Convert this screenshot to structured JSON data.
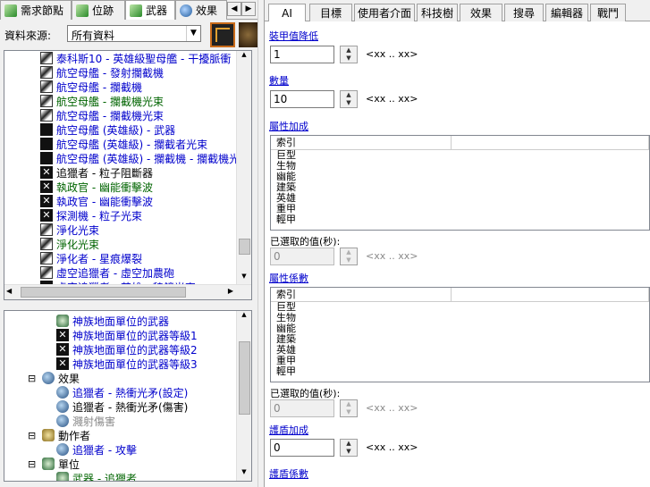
{
  "left_tabs": [
    {
      "label": "需求節點",
      "icon": "green"
    },
    {
      "label": "位跡",
      "icon": "green"
    },
    {
      "label": "武器",
      "icon": "green"
    },
    {
      "label": "效果",
      "icon": "blue"
    }
  ],
  "right_tabs": [
    "AI",
    "目標",
    "使用者介面",
    "科技樹",
    "效果",
    "搜尋",
    "編輯器",
    "戰鬥"
  ],
  "source": {
    "label": "資料來源:",
    "value": "所有資料"
  },
  "weapon_list": [
    {
      "text": "泰科斯10 - 英雄級聖母艦 - 干擾脈衝",
      "color": "blue",
      "icon": "leaf"
    },
    {
      "text": "航空母艦 - 發射攔截機",
      "color": "blue",
      "icon": "leaf"
    },
    {
      "text": "航空母艦 - 攔截機",
      "color": "blue",
      "icon": "leaf"
    },
    {
      "text": "航空母艦 - 攔截機光束",
      "color": "green",
      "icon": "leaf"
    },
    {
      "text": "航空母艦 - 攔截機光束",
      "color": "blue",
      "icon": "leaf"
    },
    {
      "text": "航空母艦 (英雄級) - 武器",
      "color": "blue",
      "icon": "dark"
    },
    {
      "text": "航空母艦 (英雄級) - 攔截者光束",
      "color": "blue",
      "icon": "dark"
    },
    {
      "text": "航空母艦 (英雄級) - 攔截機 - 攔截機光束",
      "color": "blue",
      "icon": "dark"
    },
    {
      "text": "追獵者 - 粒子阻斷器",
      "color": "black",
      "icon": "x"
    },
    {
      "text": "執政官 - 幽能衝擊波",
      "color": "green",
      "icon": "x"
    },
    {
      "text": "執政官 - 幽能衝擊波",
      "color": "blue",
      "icon": "x"
    },
    {
      "text": "探測機 - 粒子光束",
      "color": "blue",
      "icon": "x"
    },
    {
      "text": "淨化光束",
      "color": "blue",
      "icon": "leaf"
    },
    {
      "text": "淨化光束",
      "color": "green",
      "icon": "leaf"
    },
    {
      "text": "淨化者 - 星痕爆裂",
      "color": "blue",
      "icon": "leaf"
    },
    {
      "text": "虛空追獵者 - 虛空加農砲",
      "color": "blue",
      "icon": "leaf"
    },
    {
      "text": "虛空追獵者 - 英雄 - 稜鏡光束",
      "color": "blue",
      "icon": "dark"
    }
  ],
  "tree": [
    {
      "text": "神族地面單位的武器",
      "color": "blue",
      "icon": "bug",
      "indent": 58,
      "toggle": ""
    },
    {
      "text": "神族地面單位的武器等級1",
      "color": "blue",
      "icon": "x",
      "indent": 58,
      "toggle": ""
    },
    {
      "text": "神族地面單位的武器等級2",
      "color": "blue",
      "icon": "x",
      "indent": 58,
      "toggle": ""
    },
    {
      "text": "神族地面單位的武器等級3",
      "color": "blue",
      "icon": "x",
      "indent": 58,
      "toggle": ""
    },
    {
      "text": "效果",
      "color": "black",
      "icon": "ball",
      "indent": 26,
      "toggle": "⊟"
    },
    {
      "text": "追獵者 - 熱衝光矛(設定)",
      "color": "blue",
      "icon": "ball",
      "indent": 58,
      "toggle": ""
    },
    {
      "text": "追獵者 - 熱衝光矛(傷害)",
      "color": "black",
      "icon": "ball",
      "indent": 58,
      "toggle": ""
    },
    {
      "text": "濺射傷害",
      "color": "gray",
      "icon": "ball",
      "indent": 58,
      "toggle": ""
    },
    {
      "text": "動作者",
      "color": "black",
      "icon": "gold",
      "indent": 26,
      "toggle": "⊟"
    },
    {
      "text": "追獵者 - 攻擊",
      "color": "blue",
      "icon": "ball",
      "indent": 58,
      "toggle": ""
    },
    {
      "text": "單位",
      "color": "black",
      "icon": "bug",
      "indent": 26,
      "toggle": "⊟"
    },
    {
      "text": "武器 - 追獵者",
      "color": "green",
      "icon": "bug",
      "indent": 58,
      "toggle": ""
    }
  ],
  "props": {
    "armor_reduction": {
      "label": "裝甲值降低",
      "value": "1",
      "hint": "<xx .. xx>"
    },
    "count": {
      "label": "數量",
      "value": "10",
      "hint": "<xx .. xx>"
    },
    "attr_bonus": {
      "label": "屬性加成",
      "header_index": "索引",
      "items": [
        "巨型",
        "生物",
        "幽能",
        "建築",
        "英雄",
        "重甲",
        "輕甲"
      ],
      "selected_label": "已選取的值(秒):",
      "selected_value": "0",
      "hint": "<xx .. xx>"
    },
    "attr_factor": {
      "label": "屬性係數",
      "header_index": "索引",
      "items": [
        "巨型",
        "生物",
        "幽能",
        "建築",
        "英雄",
        "重甲",
        "輕甲"
      ],
      "selected_label": "已選取的值(秒):",
      "selected_value": "0",
      "hint": "<xx .. xx>"
    },
    "shield_bonus": {
      "label": "護盾加成",
      "value": "0",
      "hint": "<xx .. xx>"
    },
    "shield_factor": {
      "label": "護盾係數"
    }
  }
}
